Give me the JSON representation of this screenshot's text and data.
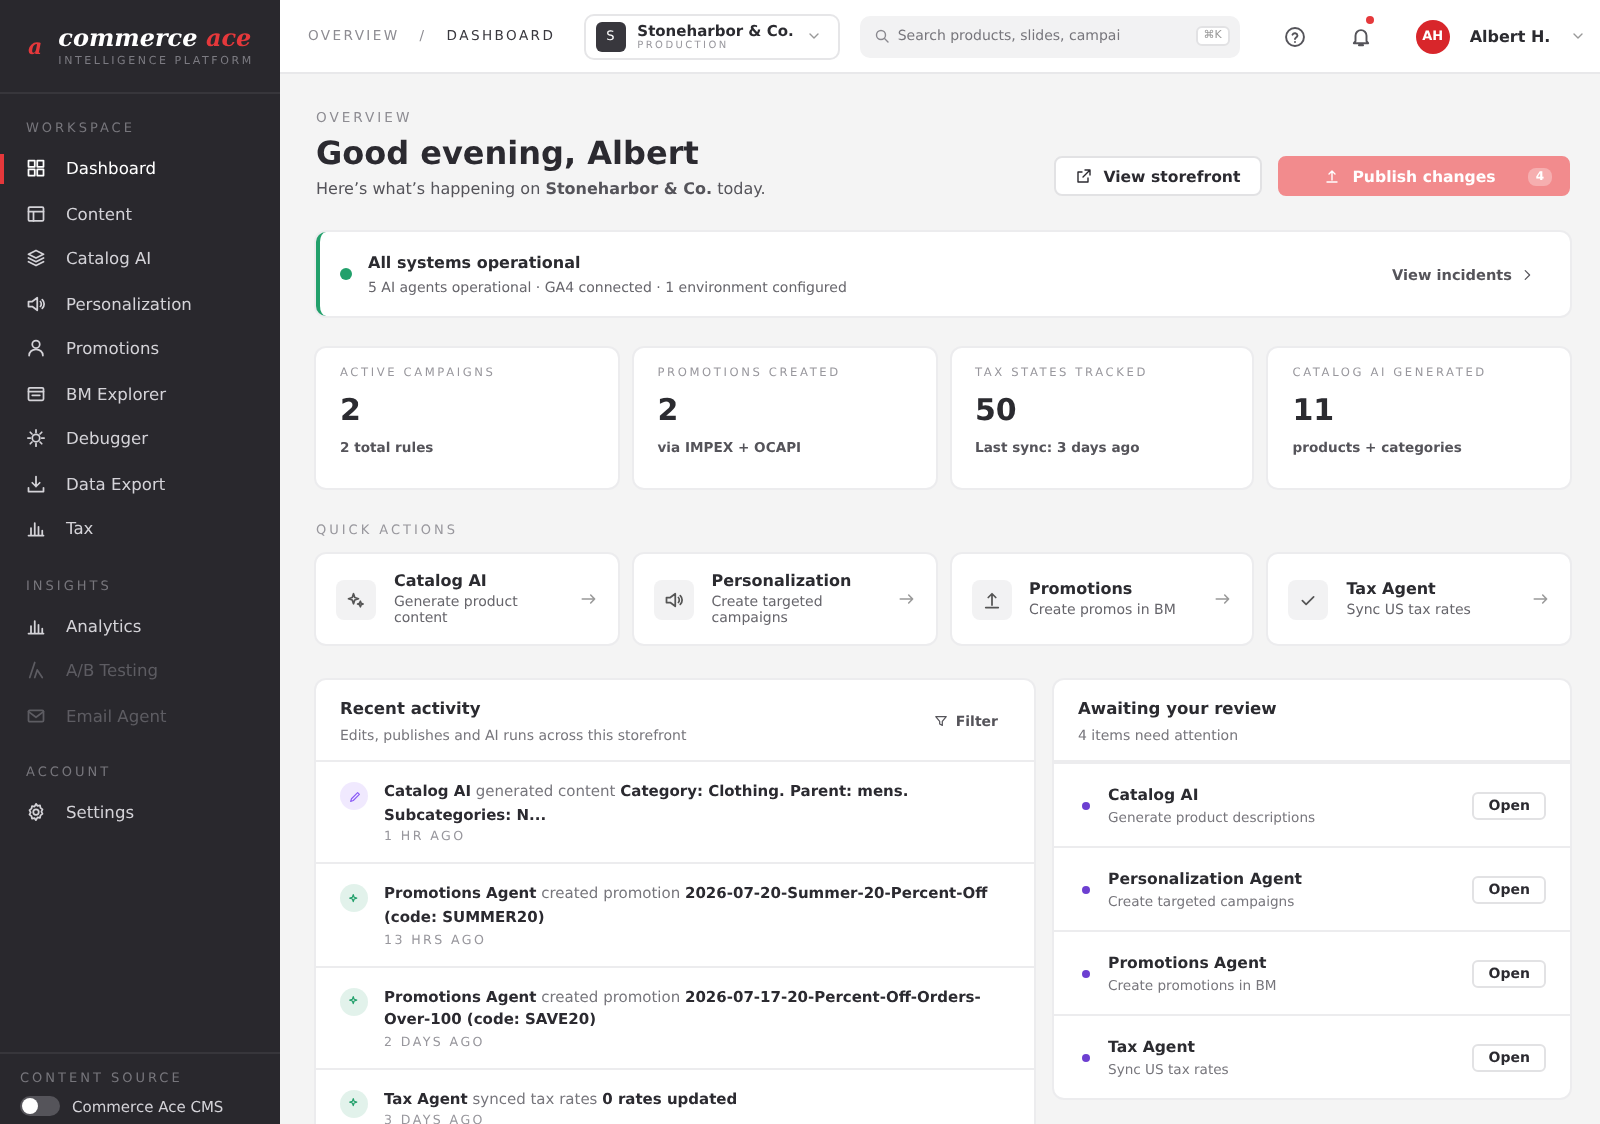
{
  "brand": {
    "mark": "a",
    "name": "commerce",
    "accent": "ace",
    "tagline": "INTELLIGENCE PLATFORM"
  },
  "sidebar": {
    "sections": [
      {
        "title": "WORKSPACE",
        "items": [
          {
            "label": "Dashboard",
            "selected": true,
            "disabled": false
          },
          {
            "label": "Content",
            "selected": false,
            "disabled": false
          },
          {
            "label": "Catalog AI",
            "selected": false,
            "disabled": false
          },
          {
            "label": "Personalization",
            "selected": false,
            "disabled": false
          },
          {
            "label": "Promotions",
            "selected": false,
            "disabled": false
          },
          {
            "label": "BM Explorer",
            "selected": false,
            "disabled": false
          },
          {
            "label": "Debugger",
            "selected": false,
            "disabled": false
          },
          {
            "label": "Data Export",
            "selected": false,
            "disabled": false
          },
          {
            "label": "Tax",
            "selected": false,
            "disabled": false
          }
        ]
      },
      {
        "title": "INSIGHTS",
        "items": [
          {
            "label": "Analytics",
            "selected": false,
            "disabled": false
          },
          {
            "label": "A/B Testing",
            "selected": false,
            "disabled": true
          },
          {
            "label": "Email Agent",
            "selected": false,
            "disabled": true
          }
        ]
      },
      {
        "title": "ACCOUNT",
        "items": [
          {
            "label": "Settings",
            "selected": false,
            "disabled": false
          }
        ]
      }
    ],
    "content_source": {
      "title": "CONTENT SOURCE",
      "label": "Commerce Ace CMS",
      "on": false
    }
  },
  "topbar": {
    "breadcrumb": [
      "OVERVIEW",
      "DASHBOARD"
    ],
    "separator": "/",
    "store": {
      "initial": "S",
      "name": "Stoneharbor & Co.",
      "env": "PRODUCTION"
    },
    "search": {
      "placeholder": "Search products, slides, campai",
      "shortcut": "⌘K"
    },
    "user": {
      "initials": "AH",
      "name": "Albert H."
    }
  },
  "header": {
    "eyebrow": "OVERVIEW",
    "title": "Good evening, Albert",
    "subtitle": "Here’s what’s happening on **Stoneharbor & Co.** today.",
    "buttons": [
      {
        "label": "View storefront",
        "kind": "secondary"
      },
      {
        "label": "Publish changes",
        "kind": "primary",
        "badge": "4"
      }
    ]
  },
  "status": {
    "title": "All systems operational",
    "detail": "5 AI agents operational · GA4 connected · 1 environment configured",
    "link": "View incidents"
  },
  "stats": [
    {
      "label": "ACTIVE CAMPAIGNS",
      "value": "2",
      "note": "2 total rules"
    },
    {
      "label": "PROMOTIONS CREATED",
      "value": "2",
      "note": "via IMPEX + OCAPI"
    },
    {
      "label": "TAX STATES TRACKED",
      "value": "50",
      "note": "Last sync: 3 days ago"
    },
    {
      "label": "CATALOG AI GENERATED",
      "value": "11",
      "note": "products + categories"
    }
  ],
  "quick_actions": {
    "title": "QUICK ACTIONS",
    "items": [
      {
        "title": "Catalog AI",
        "subtitle": "Generate product content"
      },
      {
        "title": "Personalization",
        "subtitle": "Create targeted campaigns"
      },
      {
        "title": "Promotions",
        "subtitle": "Create promos in BM"
      },
      {
        "title": "Tax Agent",
        "subtitle": "Sync US tax rates"
      }
    ]
  },
  "recent_activity": {
    "title": "Recent activity",
    "subtitle": "Edits, publishes and AI runs across this storefront",
    "filter": "Filter",
    "items": [
      {
        "text": "**Catalog AI** generated content **Category: Clothing. Parent: mens. Subcategories: N...**",
        "time": "1 HR AGO",
        "color": "#8b5cf6"
      },
      {
        "text": "**Promotions Agent** created promotion **2026-07-20-Summer-20-Percent-Off (code: SUMMER20)**",
        "time": "13 HRS AGO",
        "color": "#22a06b"
      },
      {
        "text": "**Promotions Agent** created promotion **2026-07-17-20-Percent-Off-Orders-Over-100 (code: SAVE20)**",
        "time": "2 DAYS AGO",
        "color": "#22a06b"
      },
      {
        "text": "**Tax Agent** synced tax rates **0 rates updated**",
        "time": "3 DAYS AGO",
        "color": "#22a06b"
      }
    ]
  },
  "review": {
    "title": "Awaiting your review",
    "subtitle": "4 items need attention",
    "items": [
      {
        "title": "Catalog AI",
        "subtitle": "Generate product descriptions",
        "action": "Open"
      },
      {
        "title": "Personalization Agent",
        "subtitle": "Create targeted campaigns",
        "action": "Open"
      },
      {
        "title": "Promotions Agent",
        "subtitle": "Create promotions in BM",
        "action": "Open"
      },
      {
        "title": "Tax Agent",
        "subtitle": "Sync US tax rates",
        "action": "Open"
      }
    ]
  }
}
